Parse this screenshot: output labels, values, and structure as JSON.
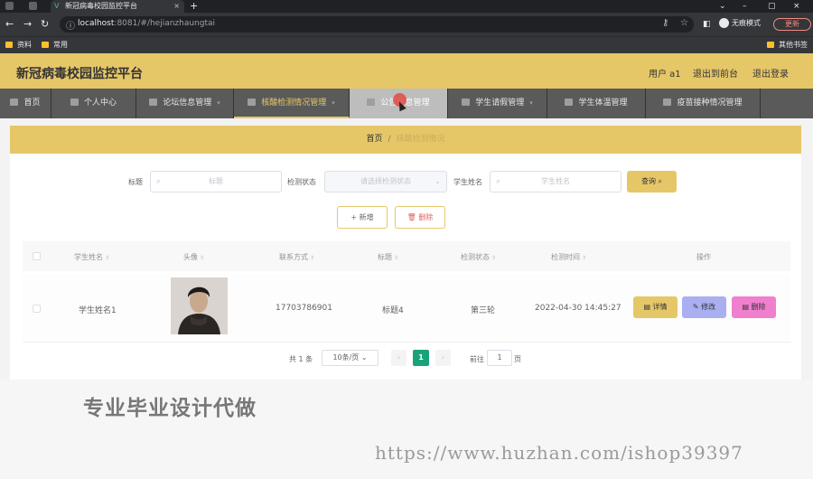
{
  "browser": {
    "tab_title": "新冠病毒校园监控平台",
    "new_tab": "+",
    "url_host": "localhost",
    "url_rest": ":8081/#/hejianzhaungtai",
    "incognito_label": "无痕模式",
    "update_label": "更新",
    "bookmarks": [
      "资料",
      "常用"
    ],
    "other_bookmarks": "其他书签"
  },
  "app": {
    "title": "新冠病毒校园监控平台",
    "user_label": "用户 a1",
    "back_to_front": "退出到前台",
    "logout": "退出登录"
  },
  "nav": [
    {
      "label": "首页"
    },
    {
      "label": "个人中心"
    },
    {
      "label": "论坛信息管理"
    },
    {
      "label": "核酸检测情况管理"
    },
    {
      "label": "公告信息管理"
    },
    {
      "label": "学生请假管理"
    },
    {
      "label": "学生体温管理"
    },
    {
      "label": "疫苗接种情况管理"
    }
  ],
  "breadcrumb": {
    "home": "首页",
    "separator": "/",
    "current": "核酸检测情况"
  },
  "filters": {
    "title_label": "标题",
    "title_placeholder": "标题",
    "status_label": "检测状态",
    "status_placeholder": "请选择检测状态",
    "name_label": "学生姓名",
    "name_placeholder": "学生姓名",
    "query_button": "查询"
  },
  "actions": {
    "add_label": "+ 新增",
    "delete_label": "删除"
  },
  "table": {
    "headers": [
      "学生姓名",
      "头像",
      "联系方式",
      "标题",
      "检测状态",
      "检测时间",
      "操作"
    ],
    "rows": [
      {
        "name": "学生姓名1",
        "phone": "17703786901",
        "title": "标题4",
        "status": "第三轮",
        "time": "2022-04-30 14:45:27"
      }
    ],
    "row_buttons": {
      "detail": "详情",
      "edit": "修改",
      "delete": "删除"
    },
    "colors": {
      "detail": "#e6c768",
      "edit": "#a9aff0",
      "delete": "#f07fcf"
    }
  },
  "pagination": {
    "total": "共 1 条",
    "page_size": "10条/页",
    "prev": "‹",
    "current": "1",
    "next": "›",
    "goto_label": "前往",
    "goto_value": "1",
    "page_suffix": "页"
  },
  "overlay": {
    "promo": "专业毕业设计代做",
    "watermark": "https://www.huzhan.com/ishop39397"
  },
  "colors": {
    "accent": "#e6c768",
    "nav_bg": "#5a5a5a",
    "page_current": "#1aa37a"
  }
}
